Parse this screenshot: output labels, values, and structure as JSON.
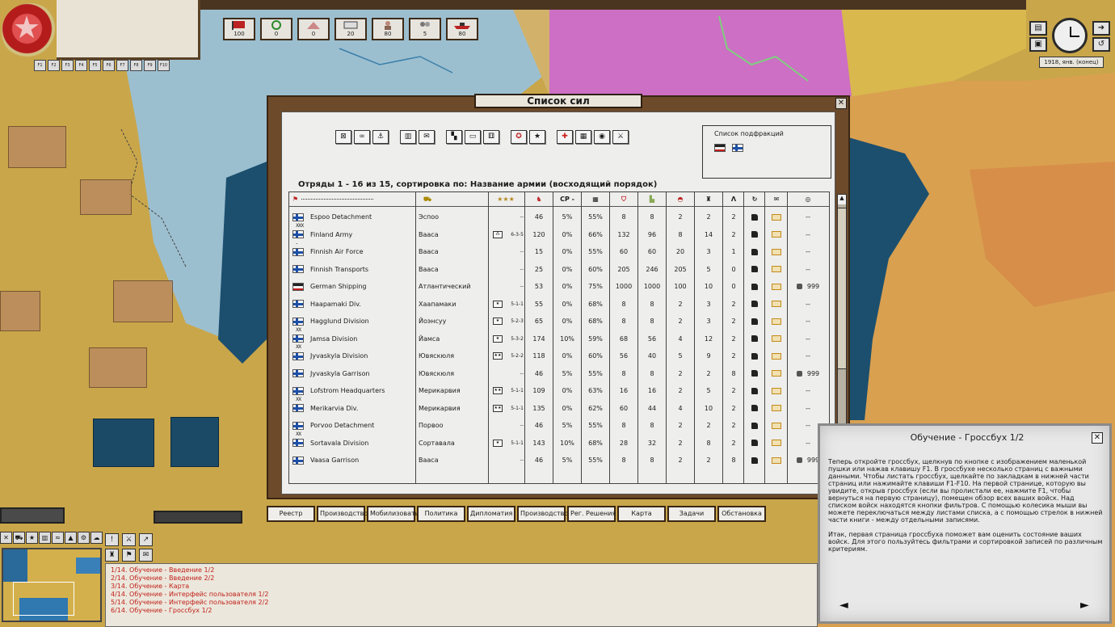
{
  "colors": {
    "accent_red": "#c0201a",
    "finland_blue": "#1d4fa6",
    "frame_brown": "#6d4a2a"
  },
  "top_bar": {
    "hotkeys": [
      "F1",
      "F2",
      "F3",
      "F4",
      "F5",
      "F6",
      "F7",
      "F8",
      "F9",
      "F10"
    ],
    "resources": [
      {
        "icon": "flag-icon",
        "value": "100"
      },
      {
        "icon": "wreath-icon",
        "value": "0"
      },
      {
        "icon": "tent-icon",
        "value": "0"
      },
      {
        "icon": "supply-crate-icon",
        "value": "20"
      },
      {
        "icon": "officer-icon",
        "value": "80"
      },
      {
        "icon": "manpower-icon",
        "value": "5"
      },
      {
        "icon": "warship-icon",
        "value": "80"
      }
    ]
  },
  "clock": {
    "date": "1918, янв. (конец)"
  },
  "window": {
    "title": "Список сил",
    "sort_line": "Отряды 1 - 16 из  15, сортировка по: Название армии  (восходящий порядок)",
    "subfactions_title": "Список подфракций",
    "columns": {
      "cp": "CP -"
    },
    "rows": [
      {
        "rank": "",
        "name": "Espoo Detachment",
        "base": "Эспоо",
        "type": "",
        "cmd": "--",
        "c1": "46",
        "cp": "5%",
        "c3": "55%",
        "c4": "8",
        "c5": "8",
        "c6": "2",
        "c7": "2",
        "c8": "2",
        "extra": "--",
        "lock": false
      },
      {
        "rank": "XXX",
        "name": "Finland Army",
        "base": "Вааса",
        "type": "⁂",
        "cmd": "6-3-5",
        "c1": "120",
        "cp": "0%",
        "c3": "66%",
        "c4": "132",
        "c5": "96",
        "c6": "8",
        "c7": "14",
        "c8": "2",
        "extra": "--",
        "lock": false
      },
      {
        "rank": "..",
        "name": "Finnish Air Force",
        "base": "Вааса",
        "type": "",
        "cmd": "--",
        "c1": "15",
        "cp": "0%",
        "c3": "55%",
        "c4": "60",
        "c5": "60",
        "c6": "20",
        "c7": "3",
        "c8": "1",
        "extra": "--",
        "lock": false
      },
      {
        "rank": "",
        "name": "Finnish Transports",
        "base": "Вааса",
        "type": "",
        "cmd": "--",
        "c1": "25",
        "cp": "0%",
        "c3": "60%",
        "c4": "205",
        "c5": "246",
        "c6": "205",
        "c7": "5",
        "c8": "0",
        "extra": "--",
        "lock": false
      },
      {
        "rank": "",
        "name": "German Shipping",
        "base": "Атлантический",
        "type": "",
        "cmd": "--",
        "c1": "53",
        "cp": "0%",
        "c3": "75%",
        "c4": "1000",
        "c5": "1000",
        "c6": "100",
        "c7": "10",
        "c8": "0",
        "extra": "999",
        "lock": true
      },
      {
        "rank": "",
        "name": "Haapamaki Div.",
        "base": "Хаапамаки",
        "type": "★",
        "cmd": "5-1-1",
        "c1": "55",
        "cp": "0%",
        "c3": "68%",
        "c4": "8",
        "c5": "8",
        "c6": "2",
        "c7": "3",
        "c8": "2",
        "extra": "--",
        "lock": false
      },
      {
        "rank": "",
        "name": "Hagglund Division",
        "base": "Йоэнсуу",
        "type": "★",
        "cmd": "5-2-3",
        "c1": "65",
        "cp": "0%",
        "c3": "68%",
        "c4": "8",
        "c5": "8",
        "c6": "2",
        "c7": "3",
        "c8": "2",
        "extra": "--",
        "lock": false
      },
      {
        "rank": "XX",
        "name": "Jamsa Division",
        "base": "Йамса",
        "type": "★",
        "cmd": "5-3-2",
        "c1": "174",
        "cp": "10%",
        "c3": "59%",
        "c4": "68",
        "c5": "56",
        "c6": "4",
        "c7": "12",
        "c8": "2",
        "extra": "--",
        "lock": false
      },
      {
        "rank": "XX",
        "name": "Jyvaskyla Division",
        "base": "Ювяскюля",
        "type": "★★",
        "cmd": "5-2-2",
        "c1": "118",
        "cp": "0%",
        "c3": "60%",
        "c4": "56",
        "c5": "40",
        "c6": "5",
        "c7": "9",
        "c8": "2",
        "extra": "--",
        "lock": false
      },
      {
        "rank": "",
        "name": "Jyvaskyla Garrison",
        "base": "Ювяскюля",
        "type": "",
        "cmd": "--",
        "c1": "46",
        "cp": "5%",
        "c3": "55%",
        "c4": "8",
        "c5": "8",
        "c6": "2",
        "c7": "2",
        "c8": "8",
        "extra": "999",
        "lock": true
      },
      {
        "rank": "",
        "name": "Lofstrom Headquarters",
        "base": "Мерикарвия",
        "type": "★★",
        "cmd": "5-1-1",
        "c1": "109",
        "cp": "0%",
        "c3": "63%",
        "c4": "16",
        "c5": "16",
        "c6": "2",
        "c7": "5",
        "c8": "2",
        "extra": "--",
        "lock": false
      },
      {
        "rank": "XX",
        "name": "Merikarvia Div.",
        "base": "Мерикарвия",
        "type": "★★",
        "cmd": "5-1-1",
        "c1": "135",
        "cp": "0%",
        "c3": "62%",
        "c4": "60",
        "c5": "44",
        "c6": "4",
        "c7": "10",
        "c8": "2",
        "extra": "--",
        "lock": false
      },
      {
        "rank": "",
        "name": "Porvoo Detachment",
        "base": "Порвоо",
        "type": "",
        "cmd": "--",
        "c1": "46",
        "cp": "5%",
        "c3": "55%",
        "c4": "8",
        "c5": "8",
        "c6": "2",
        "c7": "2",
        "c8": "2",
        "extra": "--",
        "lock": false
      },
      {
        "rank": "XX",
        "name": "Sortavala Division",
        "base": "Сортавала",
        "type": "★",
        "cmd": "5-1-1",
        "c1": "143",
        "cp": "10%",
        "c3": "68%",
        "c4": "28",
        "c5": "32",
        "c6": "2",
        "c7": "8",
        "c8": "2",
        "extra": "--",
        "lock": false
      },
      {
        "rank": "",
        "name": "Vaasa Garrison",
        "base": "Вааса",
        "type": "",
        "cmd": "--",
        "c1": "46",
        "cp": "5%",
        "c3": "55%",
        "c4": "8",
        "c5": "8",
        "c6": "2",
        "c7": "2",
        "c8": "8",
        "extra": "999",
        "lock": true
      }
    ]
  },
  "tabs": [
    "Реестр",
    "Производство",
    "Мобилизовать",
    "Политика",
    "Дипломатия",
    "Производство",
    "Рег. Решения",
    "Карта",
    "Задачи",
    "Обстановка"
  ],
  "log": [
    "1/14.  Обучение - Введение 1/2",
    "2/14.  Обучение - Введение 2/2",
    "3/14.  Обучение - Карта",
    "4/14.  Обучение - Интерфейс пользователя 1/2",
    "5/14.  Обучение - Интерфейс пользователя 2/2",
    "6/14.  Обучение - Гроссбух 1/2"
  ],
  "tutorial": {
    "title": "Обучение - Гроссбух 1/2",
    "p1": "Теперь откройте гроссбух, щелкнув по кнопке с изображением маленькой пушки или нажав клавишу F1. В гроссбухе несколько страниц с важными данными. Чтобы листать гроссбух, щелкайте по закладкам в нижней части страниц или нажимайте клавиши F1-F10. На первой странице, которую вы увидите, открыв гроссбух (если вы пролистали ее, нажмите F1, чтобы вернуться на первую страницу), помещен обзор всех ваших войск. Над списком войск находятся кнопки фильтров. С помощью колесика мыши вы можете переключаться между листами списка, а с помощью стрелок в нижней части книги - между отдельными записями.",
    "p2": "Итак, первая страница гроссбуха поможет вам оценить состояние ваших войск. Для этого пользуйтесь фильтрами и сортировкой записей по различным критериям.",
    "prev": "◄",
    "next": "►"
  }
}
